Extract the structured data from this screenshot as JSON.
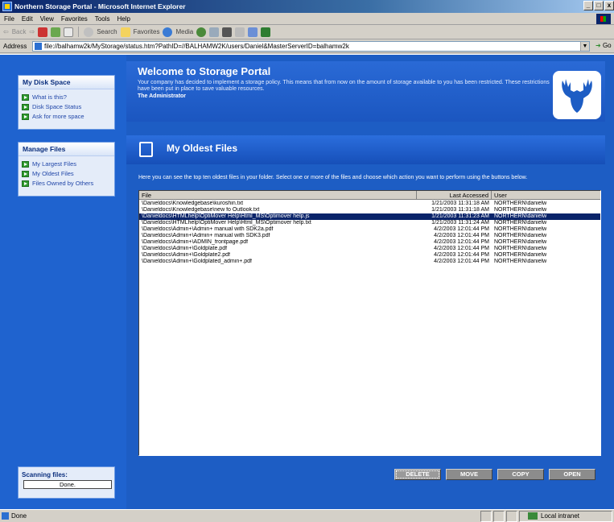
{
  "window": {
    "title": "Northern Storage Portal - Microsoft Internet Explorer",
    "controls": [
      "_",
      "□",
      "x"
    ]
  },
  "menu": [
    "File",
    "Edit",
    "View",
    "Favorites",
    "Tools",
    "Help"
  ],
  "toolbar": {
    "back": "Back",
    "search": "Search",
    "favorites": "Favorites",
    "media": "Media"
  },
  "address": {
    "label": "Address",
    "url": "file://balhamw2k/MyStorage/status.htm?PathID=//BALHAMW2K/users/Daniel&MasterServerID=balhamw2k",
    "go": "Go"
  },
  "sidebar": {
    "disk_panel": {
      "title": "My Disk Space",
      "links": [
        "What is this?",
        "Disk Space Status",
        "Ask for more space"
      ]
    },
    "files_panel": {
      "title": "Manage Files",
      "links": [
        "My Largest Files",
        "My Oldest Files",
        "Files Owned by Others"
      ]
    },
    "scan": {
      "label": "Scanning files:",
      "status": "Done."
    }
  },
  "welcome": {
    "title": "Welcome to Storage Portal",
    "text": "Your company has decided to implement a storage policy. This means that from now on the amount of storage available to you has been restricted. These restrictions have been put in place to save valuable resources.",
    "author": "The Administrator"
  },
  "section": {
    "title": "My Oldest Files",
    "intro": "Here you can see the top ten oldest files in your folder. Select one or more of the files and choose which action you want to perform using the buttons below."
  },
  "file_list": {
    "columns": [
      "File",
      "Last Accessed",
      "User"
    ],
    "rows": [
      {
        "file": "\\Danieldocs\\Knowledgebase\\kuroshin.txt",
        "date": "1/21/2003 11:31:18 AM",
        "user": "NORTHERN\\danielw",
        "selected": false
      },
      {
        "file": "\\Danieldocs\\Knowledgebase\\new fo Outlook.txt",
        "date": "1/21/2003 11:31:18 AM",
        "user": "NORTHERN\\danielw",
        "selected": false
      },
      {
        "file": "\\Danieldocs\\HTMLhelp\\OptiMover Help\\Html_MS\\Optimover help.js",
        "date": "1/21/2003 11:31:23 AM",
        "user": "NORTHERN\\danielw",
        "selected": true
      },
      {
        "file": "\\Danieldocs\\HTMLhelp\\OptiMover Help\\Html_MS\\Optimover help.txt",
        "date": "1/21/2003 11:31:24 AM",
        "user": "NORTHERN\\danielw",
        "selected": false
      },
      {
        "file": "\\Danieldocs\\Admin+\\Admin+ manual with SDK2a.pdf",
        "date": "4/2/2003 12:01:44 PM",
        "user": "NORTHERN\\danielw",
        "selected": false
      },
      {
        "file": "\\Danieldocs\\Admin+\\Admin+ manual with SDK3.pdf",
        "date": "4/2/2003 12:01:44 PM",
        "user": "NORTHERN\\danielw",
        "selected": false
      },
      {
        "file": "\\Danieldocs\\Admin+\\ADMIN_frontpage.pdf",
        "date": "4/2/2003 12:01:44 PM",
        "user": "NORTHERN\\danielw",
        "selected": false
      },
      {
        "file": "\\Danieldocs\\Admin+\\Goldplate.pdf",
        "date": "4/2/2003 12:01:44 PM",
        "user": "NORTHERN\\danielw",
        "selected": false
      },
      {
        "file": "\\Danieldocs\\Admin+\\Goldplate2.pdf",
        "date": "4/2/2003 12:01:44 PM",
        "user": "NORTHERN\\danielw",
        "selected": false
      },
      {
        "file": "\\Danieldocs\\Admin+\\Goldplated_admin+.pdf",
        "date": "4/2/2003 12:01:44 PM",
        "user": "NORTHERN\\danielw",
        "selected": false
      }
    ]
  },
  "actions": {
    "delete": "DELETE",
    "move": "MOVE",
    "copy": "COPY",
    "open": "OPEN"
  },
  "status": {
    "left": "Done",
    "zone": "Local intranet"
  },
  "colors": {
    "page_bg": "#1a56bd",
    "title_bar": "#0a246a",
    "selection": "#0a246a"
  }
}
